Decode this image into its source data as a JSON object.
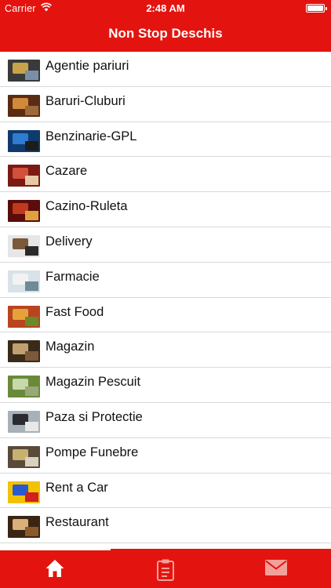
{
  "status_bar": {
    "carrier": "Carrier",
    "time": "2:48 AM"
  },
  "nav": {
    "title": "Non Stop Deschis"
  },
  "items": [
    {
      "label": "Agentie pariuri",
      "thumb": [
        "#3a3a3a",
        "#c9a34a",
        "#7a8fa6"
      ]
    },
    {
      "label": "Baruri-Cluburi",
      "thumb": [
        "#5a2c12",
        "#d08a3a",
        "#9e6a3c"
      ]
    },
    {
      "label": "Benzinarie-GPL",
      "thumb": [
        "#0f3a6e",
        "#2f7bd0",
        "#1c1c1c"
      ]
    },
    {
      "label": "Cazare",
      "thumb": [
        "#7a1a12",
        "#d24f3c",
        "#e8c7a6"
      ]
    },
    {
      "label": "Cazino-Ruleta",
      "thumb": [
        "#5a0d0a",
        "#c0391f",
        "#e0a040"
      ]
    },
    {
      "label": "Delivery",
      "thumb": [
        "#e6e6e6",
        "#7a5a3a",
        "#2a2a2a"
      ]
    },
    {
      "label": "Farmacie",
      "thumb": [
        "#d8e2e8",
        "#f2f2f2",
        "#6f8a98"
      ]
    },
    {
      "label": "Fast Food",
      "thumb": [
        "#b8451f",
        "#e6a23a",
        "#6a8a2a"
      ]
    },
    {
      "label": "Magazin",
      "thumb": [
        "#3a2a18",
        "#c0a070",
        "#7a5a3a"
      ]
    },
    {
      "label": "Magazin Pescuit",
      "thumb": [
        "#6a8a3a",
        "#c8d8a8",
        "#9aa878"
      ]
    },
    {
      "label": "Paza si Protectie",
      "thumb": [
        "#a8b0b8",
        "#2a2a30",
        "#e8e8e8"
      ]
    },
    {
      "label": "Pompe Funebre",
      "thumb": [
        "#5a4a3a",
        "#c8b070",
        "#d8d0c0"
      ]
    },
    {
      "label": "Rent a Car",
      "thumb": [
        "#f2c200",
        "#2a5ad0",
        "#d02020"
      ]
    },
    {
      "label": "Restaurant",
      "thumb": [
        "#3a2414",
        "#d8b078",
        "#8a5a2a"
      ]
    }
  ],
  "tabbar": {
    "tabs": [
      {
        "name": "home",
        "icon": "home-icon",
        "selected": true
      },
      {
        "name": "notes",
        "icon": "clipboard-icon",
        "selected": false
      },
      {
        "name": "contact",
        "icon": "mail-icon",
        "selected": false
      }
    ],
    "colors": {
      "bar": "#e3140f",
      "active": "#ffffff",
      "inactive": "#f3a09a"
    }
  }
}
